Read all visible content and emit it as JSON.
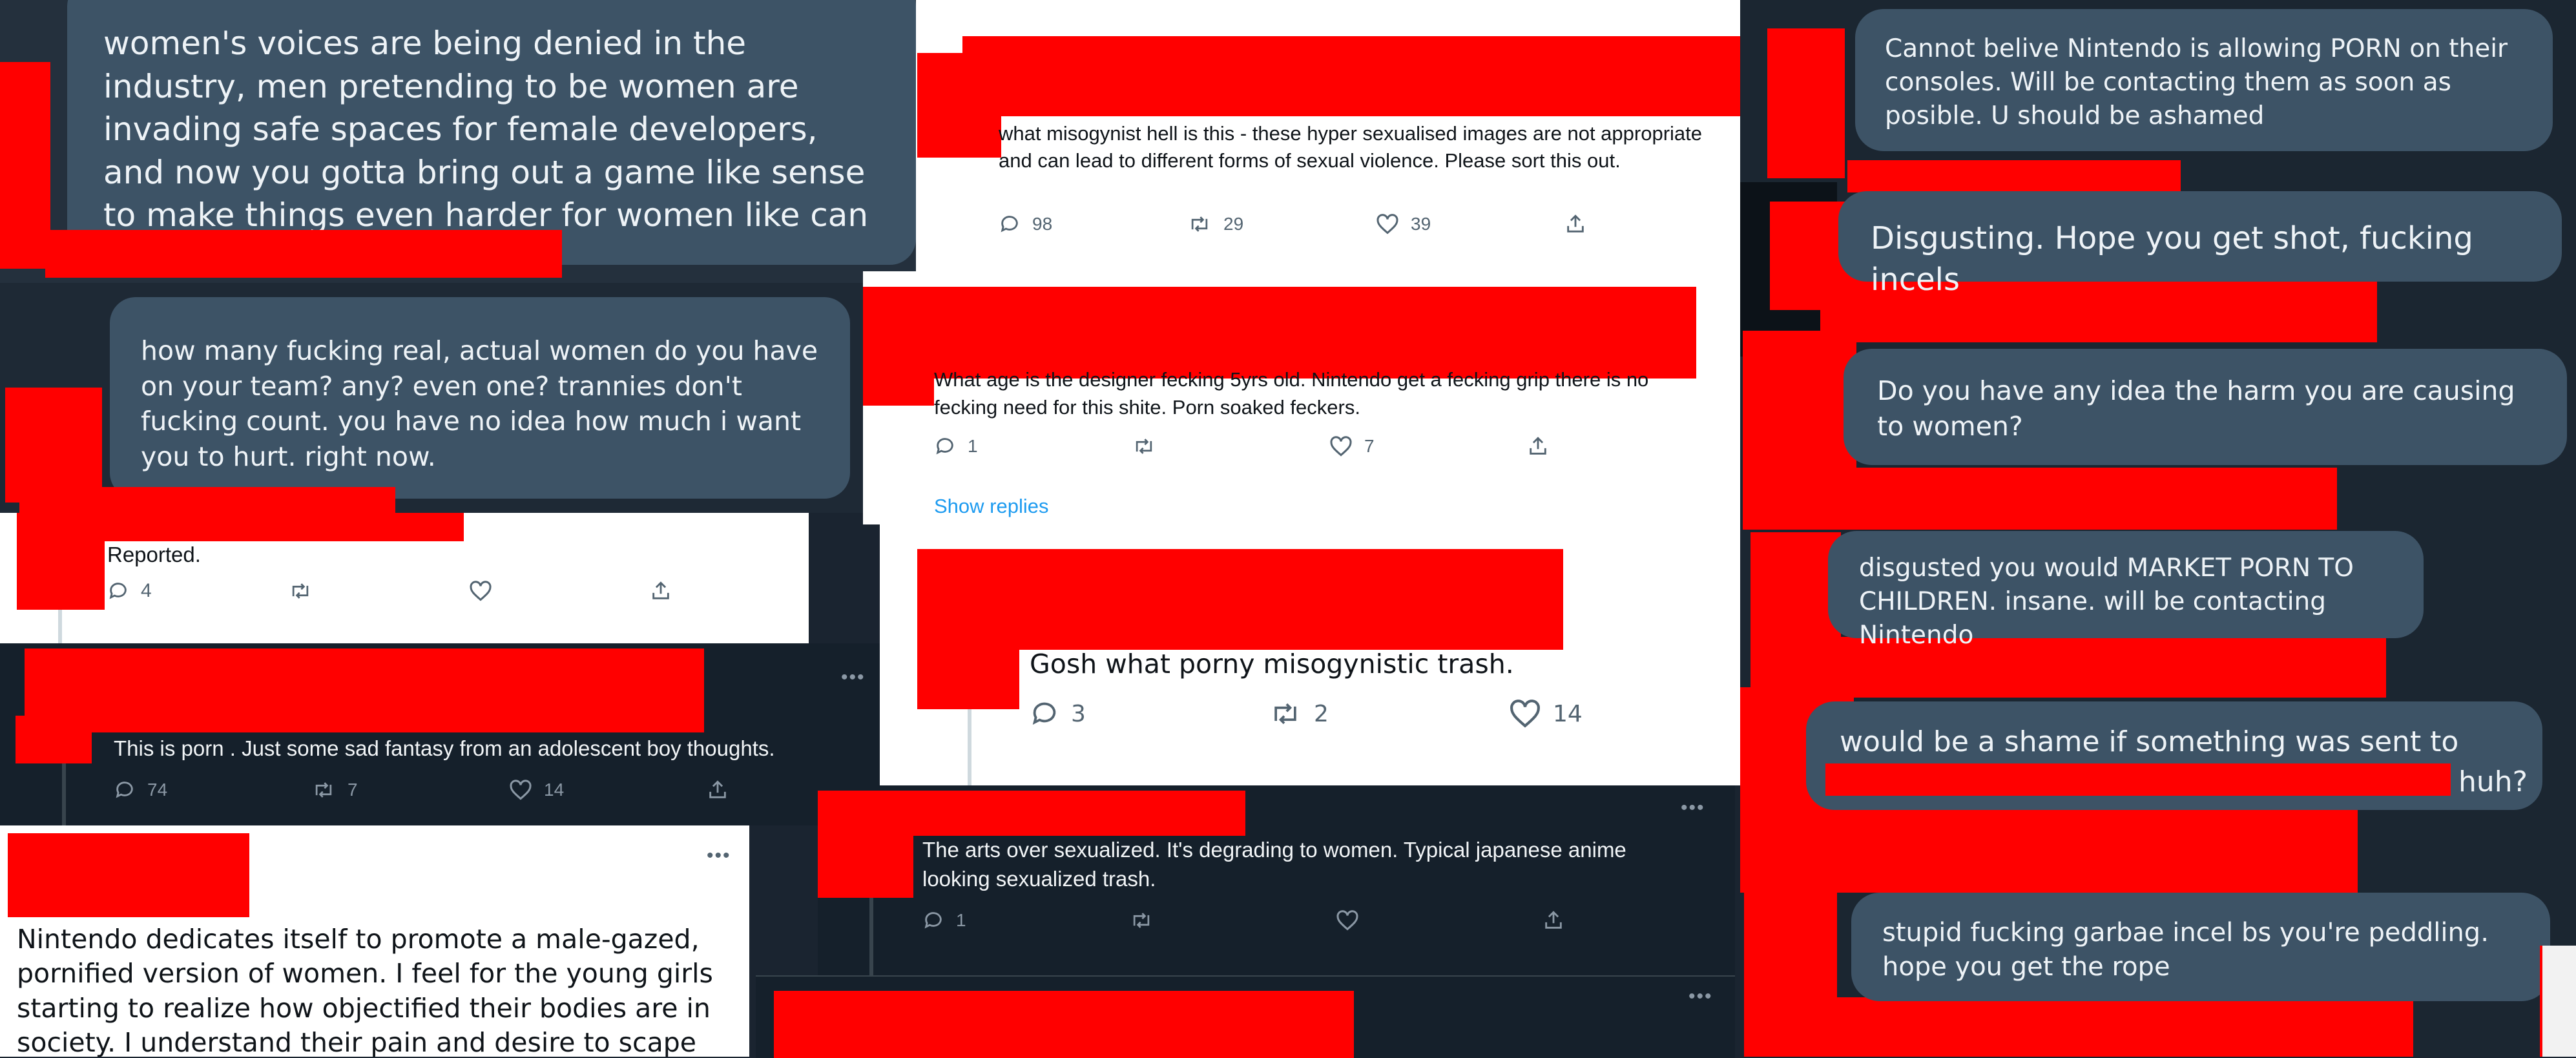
{
  "colors": {
    "redaction": "#ff0000",
    "dark_background": "#1a2430",
    "bubble_background": "#3d5366",
    "link": "#1d9bf0"
  },
  "panels": {
    "p1": {
      "text": "women's voices are being denied in the industry, men pretending to be women are invading safe spaces for female developers, and now you gotta bring out a game like sense to make things even harder for women like can you not do this?"
    },
    "p2": {
      "text": "how many fucking real, actual women do you have on your team? any? even one? trannies don't fucking count. you have no idea how much i want you to hurt. right now."
    },
    "p3": {
      "text": "Reported.",
      "reply_count": "4"
    },
    "p4": {
      "text": "This is porn . Just some sad fantasy from an adolescent boy thoughts.",
      "replies": "74",
      "retweets": "7",
      "likes": "14",
      "menu": "•••"
    },
    "p5": {
      "text": "Nintendo dedicates itself to promote a male-gazed, pornified version of women. I feel for the young girls starting to realize how objectified their bodies are in society. I understand their pain and desire to scape",
      "menu": "•••"
    },
    "p6": {
      "text": "what misogynist hell is this - these hyper sexualised images are not appropriate and can lead to different forms of sexual violence. Please sort this out.",
      "replies": "98",
      "retweets": "29",
      "likes": "39"
    },
    "p7": {
      "text": "What age is the designer fecking 5yrs old. Nintendo get a fecking grip there is no fecking need for this shite. Porn soaked feckers.",
      "replies": "1",
      "likes": "7",
      "show_replies": "Show replies"
    },
    "p8": {
      "text": "Gosh what porny misogynistic trash.",
      "replies": "3",
      "retweets": "2",
      "likes": "14"
    },
    "p9": {
      "text": "The arts over sexualized. It's degrading to women. Typical japanese anime looking sexualized trash.",
      "replies": "1",
      "menu": "•••"
    },
    "p10": {
      "menu": "•••"
    },
    "r1": {
      "text": "Cannot belive Nintendo is allowing PORN on their consoles. Will be contacting them as soon as posible. U should be ashamed"
    },
    "r2": {
      "text": "Disgusting. Hope you get shot, fucking incels"
    },
    "r3": {
      "text": "Do you have any idea the harm you are causing to women?"
    },
    "r4": {
      "text": "disgusted you would MARKET PORN TO CHILDREN. insane. will be contacting Nintendo"
    },
    "r5": {
      "text_before": "would be a shame if something was sent to",
      "text_after": "huh?"
    },
    "r6": {
      "text": "stupid fucking garbae incel bs you're peddling. hope you get the rope"
    }
  }
}
